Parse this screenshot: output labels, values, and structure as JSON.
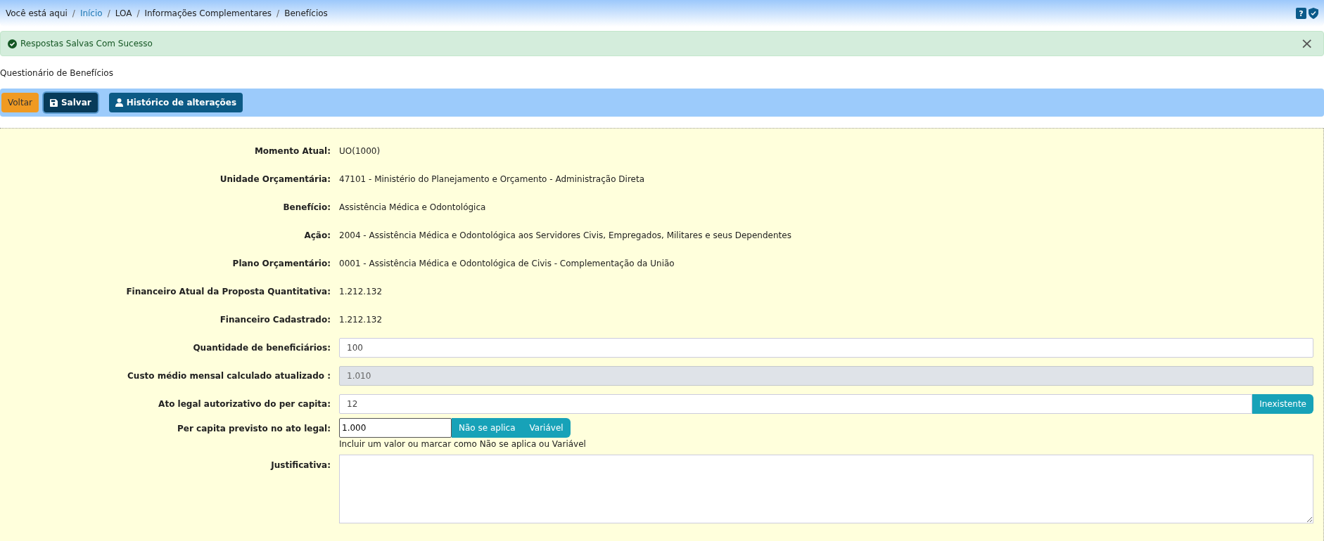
{
  "breadcrumb": {
    "prefix": "Você está aqui",
    "items": [
      {
        "label": "Início",
        "link": true
      },
      {
        "label": "LOA",
        "link": false
      },
      {
        "label": "Informações Complementares",
        "link": false
      },
      {
        "label": "Benefícios",
        "link": false
      }
    ],
    "separator": "/",
    "help": "?"
  },
  "alert": {
    "message": "Respostas Salvas Com Sucesso",
    "close": "×"
  },
  "page_title": "Questionário de Benefícios",
  "toolbar": [
    {
      "label": "Voltar",
      "kind": "warning"
    },
    {
      "label": "Salvar",
      "kind": "dark"
    },
    {
      "label": "Histórico de alterações",
      "kind": "primary"
    }
  ],
  "form": [
    {
      "label": "Momento Atual:",
      "kind": "static",
      "value": "UO(1000)"
    },
    {
      "label": "Unidade Orçamentária:",
      "kind": "static",
      "value": "47101 - Ministério do Planejamento e Orçamento - Administração Direta"
    },
    {
      "label": "Benefício:",
      "kind": "static",
      "value": "Assistência Médica e Odontológica"
    },
    {
      "label": "Ação:",
      "kind": "static",
      "value": "2004 - Assistência Médica e Odontológica aos Servidores Civis, Empregados, Militares e seus Dependentes"
    },
    {
      "label": "Plano Orçamentário:",
      "kind": "static",
      "value": "0001 - Assistência Médica e Odontológica de Civis - Complementação da União"
    },
    {
      "label": "Financeiro Atual da Proposta Quantitativa:",
      "kind": "static",
      "value": "1.212.132"
    },
    {
      "label": "Financeiro Cadastrado:",
      "kind": "static",
      "value": "1.212.132"
    },
    {
      "label": "Quantidade de beneficiários:",
      "kind": "input",
      "value": "100",
      "disabled": false
    },
    {
      "label": "Custo médio mensal calculado atualizado :",
      "kind": "input",
      "value": "1.010",
      "disabled": true
    },
    {
      "label": "Ato legal autorizativo do per capita:",
      "kind": "input",
      "value": "12",
      "disabled": false,
      "buttons": [
        "Inexistente"
      ]
    },
    {
      "label": "Per capita previsto no ato legal:",
      "kind": "short_input",
      "value": "1.000",
      "disabled": false,
      "buttons": [
        "Não se aplica",
        "Variável"
      ],
      "help": "Incluir um valor ou marcar como Não se aplica ou Variável"
    },
    {
      "label": "Justificativa:",
      "kind": "textarea"
    }
  ]
}
